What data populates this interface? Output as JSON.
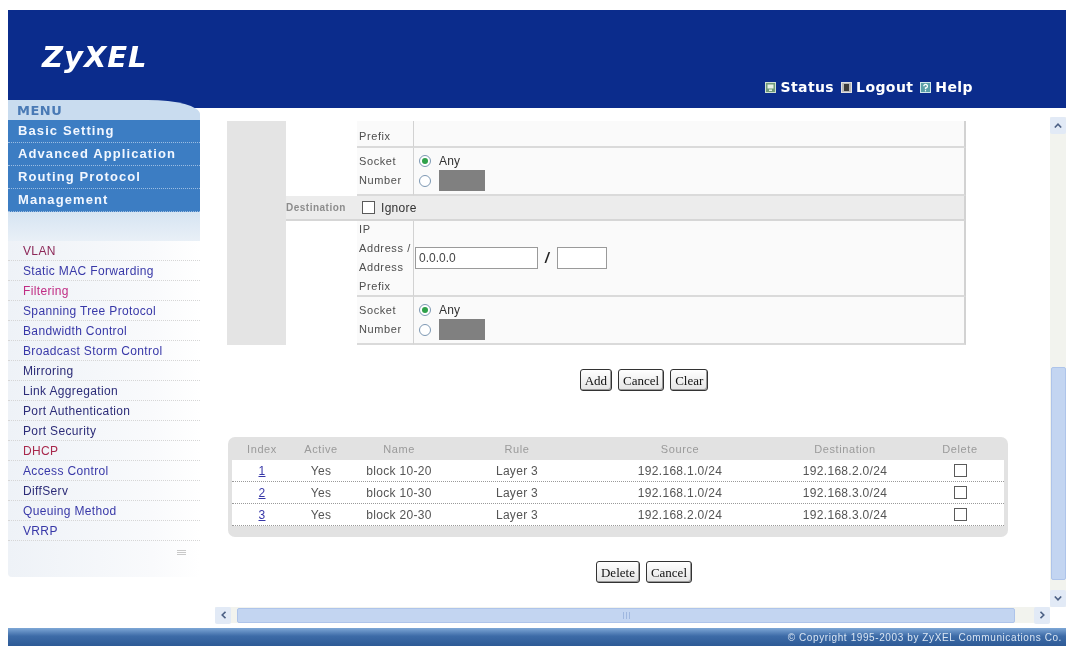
{
  "header": {
    "logo": "ZyXEL",
    "links": [
      "Status",
      "Logout",
      "Help"
    ]
  },
  "sidebar": {
    "menu_title": "MENU",
    "sections": [
      "Basic Setting",
      "Advanced Application",
      "Routing Protocol",
      "Management"
    ],
    "items": [
      {
        "label": "VLAN",
        "color": "#8c2858"
      },
      {
        "label": "Static MAC Forwarding",
        "color": "#3838a8"
      },
      {
        "label": "Filtering",
        "color": "#c02c84"
      },
      {
        "label": "Spanning Tree Protocol",
        "color": "#3838a8"
      },
      {
        "label": "Bandwidth Control",
        "color": "#3838a8"
      },
      {
        "label": "Broadcast Storm Control",
        "color": "#3838a8"
      },
      {
        "label": "Mirroring",
        "color": "#2c2c78"
      },
      {
        "label": "Link Aggregation",
        "color": "#2c2c78"
      },
      {
        "label": "Port Authentication",
        "color": "#2c2c78"
      },
      {
        "label": "Port Security",
        "color": "#2c2c78"
      },
      {
        "label": "DHCP",
        "color": "#a8284c"
      },
      {
        "label": "Access Control",
        "color": "#3838a8"
      },
      {
        "label": "DiffServ",
        "color": "#2c2c78"
      },
      {
        "label": "Queuing Method",
        "color": "#3838a8"
      },
      {
        "label": "VRRP",
        "color": "#3838a8"
      }
    ]
  },
  "form": {
    "rows": [
      {
        "kind": "label",
        "label": "Prefix"
      },
      {
        "kind": "socket",
        "label": "Socket Number",
        "options": [
          {
            "kind": "label",
            "label": "Any",
            "selected": true
          },
          {
            "kind": "field",
            "selected": false,
            "disabled": true
          }
        ]
      },
      {
        "kind": "section",
        "label": "Destination",
        "checkbox": {
          "label": "Ignore",
          "checked": false
        }
      },
      {
        "kind": "address",
        "label": "IP Address / Address Prefix",
        "address": "0.0.0.0",
        "separator": "/"
      },
      {
        "kind": "socket",
        "label": "Socket Number",
        "options": [
          {
            "kind": "label",
            "label": "Any",
            "selected": true
          },
          {
            "kind": "field",
            "selected": false,
            "disabled": true
          }
        ]
      }
    ],
    "buttons": [
      "Add",
      "Cancel",
      "Clear"
    ]
  },
  "table": {
    "columns": [
      "Index",
      "Active",
      "Name",
      "Rule",
      "Source",
      "Destination",
      "Delete"
    ],
    "rows": [
      {
        "index": "1",
        "active": "Yes",
        "name": "block 10-20",
        "rule": "Layer 3",
        "source": "192.168.1.0/24",
        "destination": "192.168.2.0/24",
        "checked": false
      },
      {
        "index": "2",
        "active": "Yes",
        "name": "block 10-30",
        "rule": "Layer 3",
        "source": "192.168.1.0/24",
        "destination": "192.168.3.0/24",
        "checked": false
      },
      {
        "index": "3",
        "active": "Yes",
        "name": "block 20-30",
        "rule": "Layer 3",
        "source": "192.168.2.0/24",
        "destination": "192.168.3.0/24",
        "checked": false
      }
    ],
    "buttons": [
      "Delete",
      "Cancel"
    ]
  },
  "footer": {
    "copyright": "© Copyright 1995-2003 by ZyXEL Communications Co."
  }
}
